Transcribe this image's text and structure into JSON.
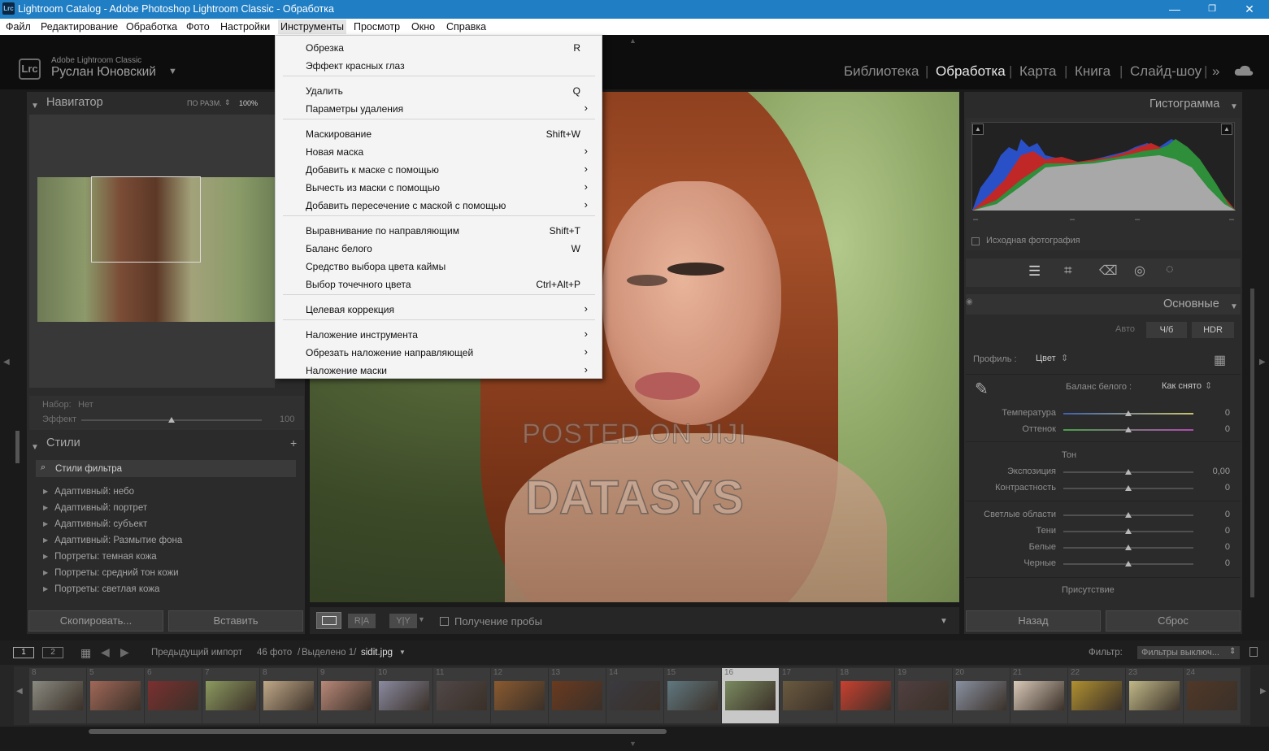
{
  "titlebar": {
    "title": "Lightroom Catalog - Adobe Photoshop Lightroom Classic - Обработка",
    "logo": "Lrc"
  },
  "menubar": [
    "Файл",
    "Редактирование",
    "Обработка",
    "Фото",
    "Настройки",
    "Инструменты",
    "Просмотр",
    "Окно",
    "Справка"
  ],
  "identity": {
    "product": "Adobe Lightroom Classic",
    "user": "Руслан Юновский",
    "badge": "Lrc"
  },
  "modules": {
    "library": "Библиотека",
    "develop": "Обработка",
    "map": "Карта",
    "book": "Книга",
    "slideshow": "Слайд-шоу",
    "more": "»"
  },
  "dropdown": {
    "items": [
      {
        "label": "Обрезка",
        "shortcut": "R"
      },
      {
        "label": "Эффект красных глаз",
        "shortcut": ""
      },
      {
        "label": "Удалить",
        "shortcut": "Q"
      },
      {
        "label": "Параметры удаления",
        "shortcut": "",
        "arrow": "›"
      },
      {
        "label": "Маскирование",
        "shortcut": "Shift+W"
      },
      {
        "label": "Новая маска",
        "shortcut": "",
        "arrow": "›"
      },
      {
        "label": "Добавить к маске с помощью",
        "shortcut": "",
        "arrow": "›"
      },
      {
        "label": "Вычесть из маски с помощью",
        "shortcut": "",
        "arrow": "›"
      },
      {
        "label": "Добавить пересечение с маской с помощью",
        "shortcut": "",
        "arrow": "›"
      },
      {
        "label": "Выравнивание по направляющим",
        "shortcut": "Shift+T"
      },
      {
        "label": "Баланс белого",
        "shortcut": "W"
      },
      {
        "label": "Средство выбора цвета каймы",
        "shortcut": ""
      },
      {
        "label": "Выбор точечного цвета",
        "shortcut": "Ctrl+Alt+P"
      },
      {
        "label": "Целевая коррекция",
        "shortcut": "",
        "arrow": "›"
      },
      {
        "label": "Наложение инструмента",
        "shortcut": "",
        "arrow": "›"
      },
      {
        "label": "Обрезать наложение направляющей",
        "shortcut": "",
        "arrow": "›"
      },
      {
        "label": "Наложение маски",
        "shortcut": "",
        "arrow": "›"
      }
    ]
  },
  "navigator": {
    "title": "Навигатор",
    "fit": "ПО РАЗМ.",
    "zoom": "100%"
  },
  "preset": {
    "set_label": "Набор:",
    "set_value": "Нет",
    "effect_label": "Эффект",
    "effect_value": "100",
    "effect_level": 0.5
  },
  "styles": {
    "title": "Стили",
    "filter": "Стили фильтра",
    "items": [
      "Адаптивный: небо",
      "Адаптивный: портрет",
      "Адаптивный: субъект",
      "Адаптивный: Размытие фона",
      "Портреты: темная кожа",
      "Портреты: средний тон кожи",
      "Портреты: светлая кожа"
    ]
  },
  "left_buttons": {
    "copy": "Скопировать...",
    "paste": "Вставить"
  },
  "image": {
    "watermark1": "POSTED ON JIJI",
    "watermark2": "DATASYS"
  },
  "toolbar": {
    "ra": "R|A",
    "yy": "Y|Y",
    "soft_proof": "Получение пробы"
  },
  "histogram": {
    "title": "Гистограмма",
    "original": "Исходная фотография",
    "dashes": [
      "–",
      "–",
      "–",
      "–"
    ]
  },
  "basic": {
    "title": "Основные",
    "auto": "Авто",
    "bw": "Ч/б",
    "hdr": "HDR",
    "profile_label": "Профиль :",
    "profile_value": "Цвет",
    "wb_label": "Баланс белого :",
    "wb_value": "Как снято",
    "tone": "Тон",
    "presence": "Присутствие",
    "sliders": [
      {
        "label": "Температура",
        "value": "0",
        "level": 0.5
      },
      {
        "label": "Оттенок",
        "value": "0",
        "level": 0.5
      },
      {
        "label": "Экспозиция",
        "value": "0,00",
        "level": 0.5
      },
      {
        "label": "Контрастность",
        "value": "0",
        "level": 0.5
      },
      {
        "label": "Светлые области",
        "value": "0",
        "level": 0.5
      },
      {
        "label": "Тени",
        "value": "0",
        "level": 0.5
      },
      {
        "label": "Белые",
        "value": "0",
        "level": 0.5
      },
      {
        "label": "Черные",
        "value": "0",
        "level": 0.5
      }
    ]
  },
  "right_buttons": {
    "back": "Назад",
    "reset": "Сброс"
  },
  "filmbar": {
    "page1": "1",
    "page2": "2",
    "source": "Предыдущий импорт",
    "count": "46 фото",
    "selected": "Выделено 1/",
    "file": "sidit.jpg",
    "filter_label": "Фильтр:",
    "filter_value": "Фильтры выключ..."
  },
  "filmstrip": {
    "numbers": [
      "8",
      "5",
      "6",
      "7",
      "8",
      "9",
      "10",
      "11",
      "12",
      "13",
      "14",
      "15",
      "16",
      "17",
      "18",
      "19",
      "20",
      "21",
      "22",
      "23",
      "24"
    ],
    "selected_index": 12
  }
}
